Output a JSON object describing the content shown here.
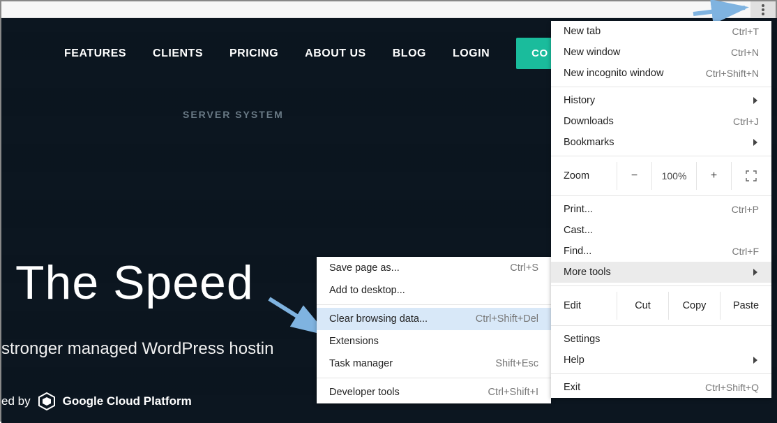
{
  "nav": {
    "features": "FEATURES",
    "clients": "CLIENTS",
    "pricing": "PRICING",
    "about": "ABOUT US",
    "blog": "BLOG",
    "login": "LOGIN",
    "contact": "CO"
  },
  "hero": {
    "title": "The Speed",
    "subtitle": "stronger managed WordPress hostin",
    "server_label": "SERVER SYSTEM",
    "powered_by": "ed by",
    "gcp": "Google Cloud Platform"
  },
  "menu": {
    "new_tab": "New tab",
    "new_tab_sc": "Ctrl+T",
    "new_window": "New window",
    "new_window_sc": "Ctrl+N",
    "incognito": "New incognito window",
    "incognito_sc": "Ctrl+Shift+N",
    "history": "History",
    "downloads": "Downloads",
    "downloads_sc": "Ctrl+J",
    "bookmarks": "Bookmarks",
    "zoom_label": "Zoom",
    "zoom_minus": "−",
    "zoom_value": "100%",
    "zoom_plus": "+",
    "print": "Print...",
    "print_sc": "Ctrl+P",
    "cast": "Cast...",
    "find": "Find...",
    "find_sc": "Ctrl+F",
    "more_tools": "More tools",
    "edit_label": "Edit",
    "cut": "Cut",
    "copy": "Copy",
    "paste": "Paste",
    "settings": "Settings",
    "help": "Help",
    "exit": "Exit",
    "exit_sc": "Ctrl+Shift+Q"
  },
  "submenu": {
    "save_page": "Save page as...",
    "save_page_sc": "Ctrl+S",
    "add_desktop": "Add to desktop...",
    "clear_data": "Clear browsing data...",
    "clear_data_sc": "Ctrl+Shift+Del",
    "extensions": "Extensions",
    "task_manager": "Task manager",
    "task_manager_sc": "Shift+Esc",
    "dev_tools": "Developer tools",
    "dev_tools_sc": "Ctrl+Shift+I"
  }
}
